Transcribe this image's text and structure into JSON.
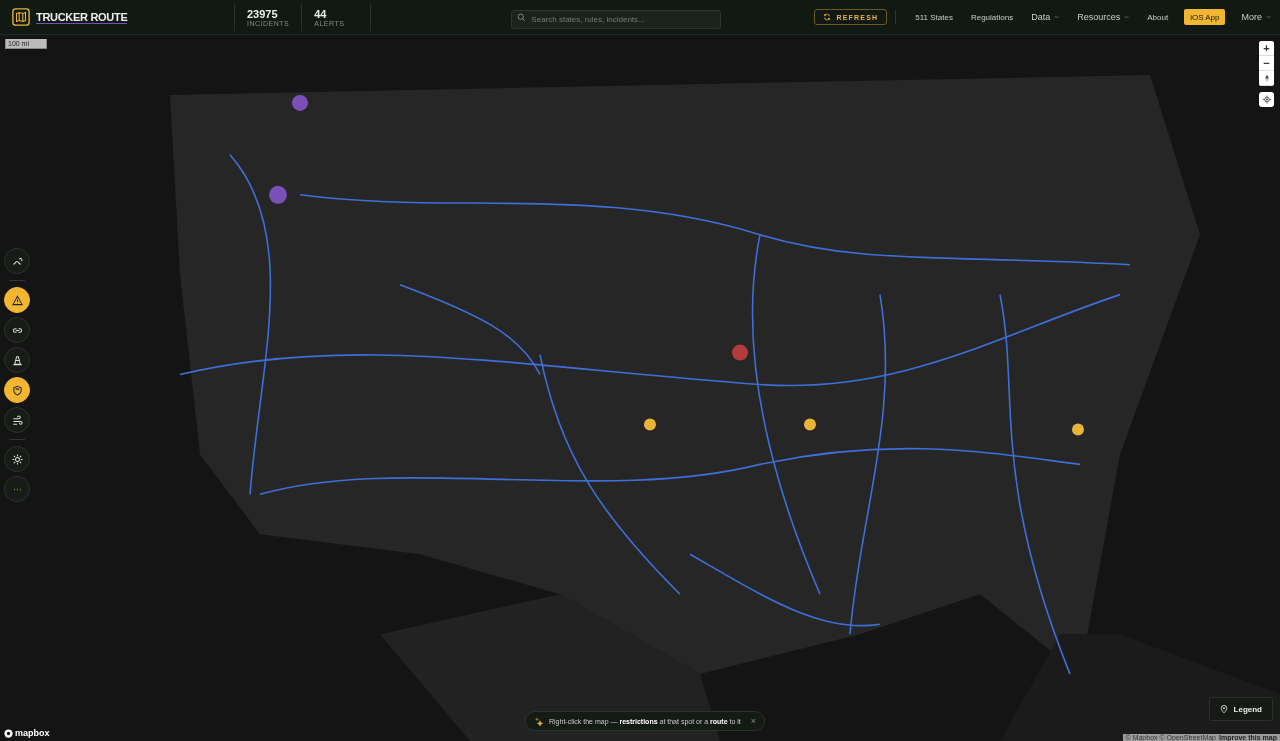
{
  "header": {
    "brand": "TRUCKER ROUTE",
    "stats": [
      {
        "value": "23975",
        "label": "INCIDENTS"
      },
      {
        "value": "44",
        "label": "ALERTS"
      }
    ],
    "search": {
      "placeholder": "Search states, rules, incidents..."
    },
    "refresh": "REFRESH",
    "nav": [
      {
        "label": "511 States",
        "kind": "link"
      },
      {
        "label": "Regulations",
        "kind": "link"
      },
      {
        "label": "Data",
        "kind": "menu"
      },
      {
        "label": "Resources",
        "kind": "menu"
      },
      {
        "label": "About",
        "kind": "link"
      },
      {
        "label": "iOS App",
        "kind": "cta"
      },
      {
        "label": "More",
        "kind": "menu"
      }
    ]
  },
  "map": {
    "kind": "picture",
    "scale": "100 mi",
    "layers": [
      {
        "kind": "snake",
        "selected": false
      },
      {
        "kind": "warning",
        "selected": true
      },
      {
        "kind": "chain",
        "selected": false
      },
      {
        "kind": "cone",
        "selected": false
      },
      {
        "kind": "shield",
        "selected": true
      },
      {
        "kind": "wind",
        "selected": false
      },
      {
        "kind": "sun",
        "selected": false
      },
      {
        "kind": "more",
        "selected": false
      }
    ],
    "hint": {
      "text": "Right-click the map — **restrictions** at that spot or a **route** to it",
      "close": "×"
    },
    "legend": "Legend",
    "logo": "mapbox",
    "attribution": "© Mapbox © OpenStreetMap",
    "improve": "Improve this map",
    "zoom_in": "+",
    "zoom_out": "−"
  }
}
